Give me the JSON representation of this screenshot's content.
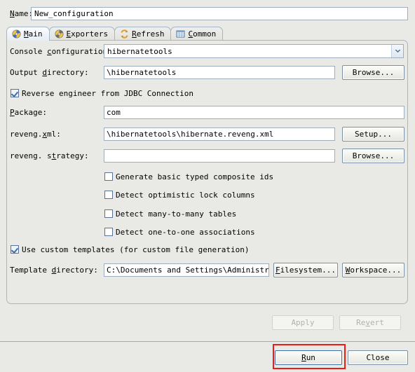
{
  "dialog": {
    "name_label": "Name:",
    "name_value": "New_configuration"
  },
  "tabs": [
    {
      "label": "Main",
      "icon": "hibernate-config-icon",
      "active": true
    },
    {
      "label": "Exporters",
      "icon": "hibernate-config-icon",
      "active": false
    },
    {
      "label": "Refresh",
      "icon": "refresh-arrows-icon",
      "active": false
    },
    {
      "label": "Common",
      "icon": "common-grid-icon",
      "active": false
    }
  ],
  "main": {
    "console_configuration": {
      "label": "Console configuration:",
      "value": "hibernatetools"
    },
    "output_directory": {
      "label": "Output directory:",
      "value": "\\hibernatetools",
      "browse_label": "Browse..."
    },
    "reverse_engineer": {
      "label": "Reverse engineer from JDBC Connection",
      "checked": true
    },
    "package": {
      "label": "Package:",
      "value": "com"
    },
    "reveng_xml": {
      "label": "reveng.xml:",
      "value": "\\hibernatetools\\hibernate.reveng.xml",
      "setup_label": "Setup..."
    },
    "reveng_strategy": {
      "label": "reveng. strategy:",
      "value": "",
      "browse_label": "Browse..."
    },
    "options": [
      {
        "label": "Generate basic typed composite ids",
        "checked": false
      },
      {
        "label": "Detect optimistic lock columns",
        "checked": false
      },
      {
        "label": "Detect many-to-many tables",
        "checked": false
      },
      {
        "label": "Detect one-to-one associations",
        "checked": false
      }
    ],
    "use_custom_templates": {
      "label": "Use custom templates (for custom file generation)",
      "checked": true
    },
    "template_directory": {
      "label": "Template directory:",
      "value": "C:\\Documents and Settings\\Administrat",
      "filesystem_label": "Filesystem...",
      "workspace_label": "Workspace..."
    }
  },
  "footer": {
    "apply_label": "Apply",
    "apply_enabled": false,
    "revert_label": "Revert",
    "revert_enabled": false,
    "run_label": "Run",
    "close_label": "Close"
  },
  "annotation": {
    "highlight_color": "#ee1b16",
    "highlight_target": "run-button"
  }
}
